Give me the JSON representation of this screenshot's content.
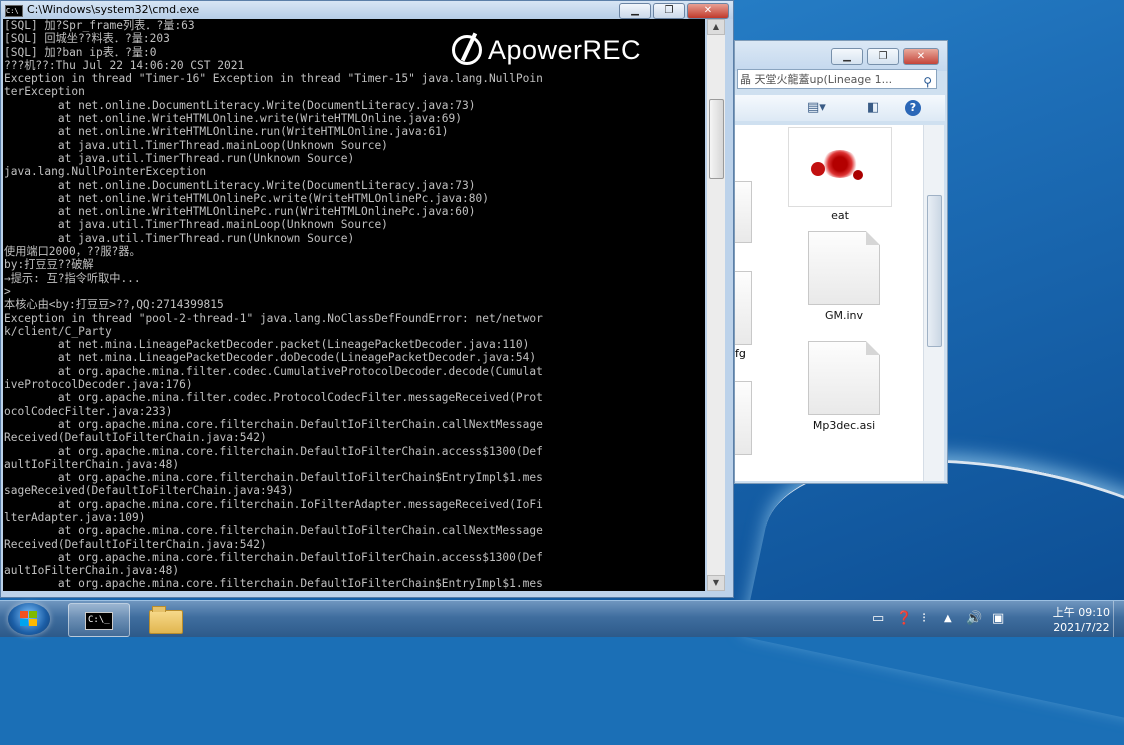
{
  "cmd": {
    "title": "C:\\Windows\\system32\\cmd.exe",
    "minimize": "▁",
    "maximize": "❐",
    "close": "✕",
    "lines": [
      "[SQL] 加?Spr_frame列表．?量:63",
      "[SQL] 回城坐??料表．?量:203",
      "[SQL] 加?ban ip表．?量:0",
      "???机??:Thu Jul 22 14:06:20 CST 2021",
      "Exception in thread \"Timer-16\" Exception in thread \"Timer-15\" java.lang.NullPoin",
      "terException",
      "        at net.online.DocumentLiteracy.Write(DocumentLiteracy.java:73)",
      "        at net.online.WriteHTMLOnline.write(WriteHTMLOnline.java:69)",
      "        at net.online.WriteHTMLOnline.run(WriteHTMLOnline.java:61)",
      "        at java.util.TimerThread.mainLoop(Unknown Source)",
      "        at java.util.TimerThread.run(Unknown Source)",
      "java.lang.NullPointerException",
      "        at net.online.DocumentLiteracy.Write(DocumentLiteracy.java:73)",
      "        at net.online.WriteHTMLOnlinePc.write(WriteHTMLOnlinePc.java:80)",
      "        at net.online.WriteHTMLOnlinePc.run(WriteHTMLOnlinePc.java:60)",
      "        at java.util.TimerThread.mainLoop(Unknown Source)",
      "        at java.util.TimerThread.run(Unknown Source)",
      "使用端口2000，??服?器。",
      "by:打豆豆??破解",
      "→提示: 互?指令听取中...",
      ">",
      "本核心由<by:打豆豆>??,QQ:2714399815",
      "Exception in thread \"pool-2-thread-1\" java.lang.NoClassDefFoundError: net/networ",
      "k/client/C_Party",
      "        at net.mina.LineagePacketDecoder.packet(LineagePacketDecoder.java:110)",
      "        at net.mina.LineagePacketDecoder.doDecode(LineagePacketDecoder.java:54)",
      "        at org.apache.mina.filter.codec.CumulativeProtocolDecoder.decode(Cumulat",
      "iveProtocolDecoder.java:176)",
      "        at org.apache.mina.filter.codec.ProtocolCodecFilter.messageReceived(Prot",
      "ocolCodecFilter.java:233)",
      "        at org.apache.mina.core.filterchain.DefaultIoFilterChain.callNextMessage",
      "Received(DefaultIoFilterChain.java:542)",
      "        at org.apache.mina.core.filterchain.DefaultIoFilterChain.access$1300(Def",
      "aultIoFilterChain.java:48)",
      "        at org.apache.mina.core.filterchain.DefaultIoFilterChain$EntryImpl$1.mes",
      "sageReceived(DefaultIoFilterChain.java:943)",
      "        at org.apache.mina.core.filterchain.IoFilterAdapter.messageReceived(IoFi",
      "lterAdapter.java:109)",
      "        at org.apache.mina.core.filterchain.DefaultIoFilterChain.callNextMessage",
      "Received(DefaultIoFilterChain.java:542)",
      "        at org.apache.mina.core.filterchain.DefaultIoFilterChain.access$1300(Def",
      "aultIoFilterChain.java:48)",
      "        at org.apache.mina.core.filterchain.DefaultIoFilterChain$EntryImpl$1.mes"
    ]
  },
  "watermark": {
    "text": "ApowerREC"
  },
  "explorer": {
    "address": "晶 天堂火龍蓋up(Lineage 1...",
    "files": [
      {
        "label": "eat"
      },
      {
        "label": "GM.inv"
      },
      {
        "label": "Mp3dec.asi"
      },
      {
        "label": "fg"
      }
    ]
  },
  "taskbar": {
    "clock_time": "上午 09:10",
    "clock_date": "2021/7/22"
  },
  "colors": {
    "console_bg": "#000000",
    "console_fg": "#c0c0c0",
    "taskbar": "#3f6d9e",
    "desktop": "#1e6fb8"
  }
}
